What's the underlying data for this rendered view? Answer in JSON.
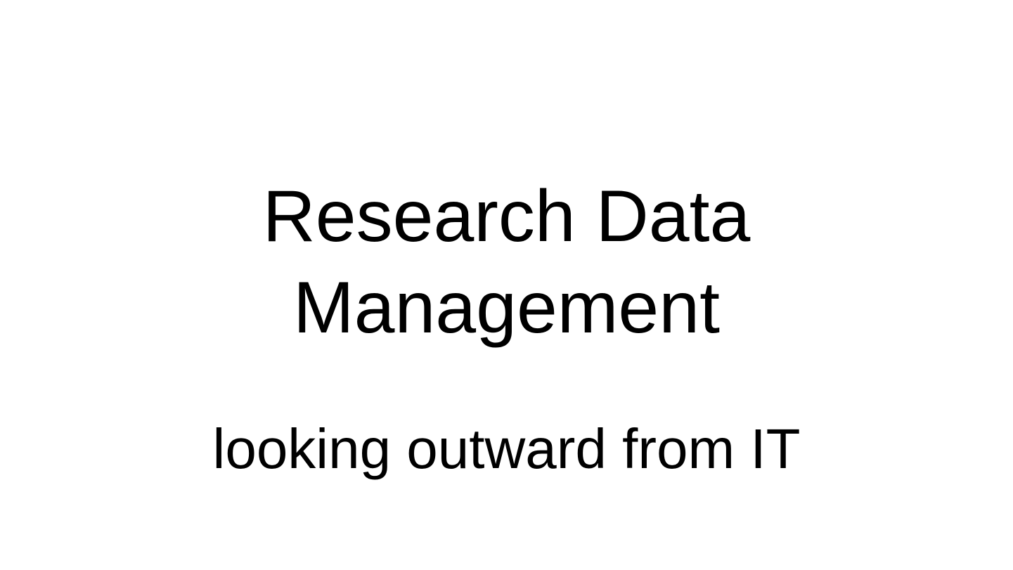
{
  "slide": {
    "title_lines": [
      "Research Data",
      "Management"
    ],
    "subtitle": "looking outward from IT"
  }
}
